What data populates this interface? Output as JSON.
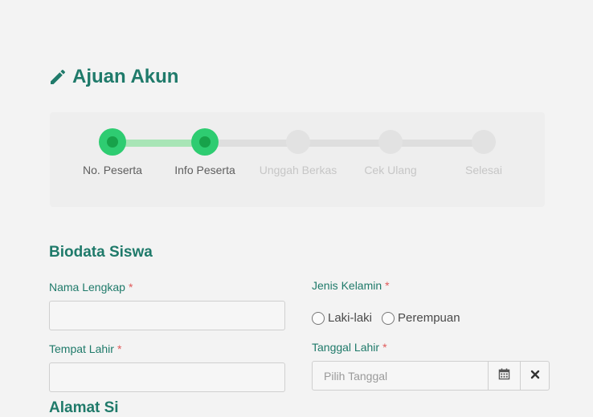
{
  "page": {
    "title": "Ajuan Akun",
    "title_icon": "pencil-icon"
  },
  "stepper": {
    "steps": [
      {
        "label": "No. Peserta",
        "active": true
      },
      {
        "label": "Info Peserta",
        "active": true
      },
      {
        "label": "Unggah Berkas",
        "active": false
      },
      {
        "label": "Cek Ulang",
        "active": false
      },
      {
        "label": "Selesai",
        "active": false
      }
    ],
    "current_step": 2
  },
  "form": {
    "section_title": "Biodata Siswa",
    "next_section_title": "Alamat Si",
    "required_marker": "*",
    "full_name": {
      "label": "Nama Lengkap",
      "value": ""
    },
    "birth_place": {
      "label": "Tempat Lahir",
      "value": ""
    },
    "gender": {
      "label": "Jenis Kelamin",
      "options": [
        "Laki-laki",
        "Perempuan"
      ]
    },
    "birth_date": {
      "label": "Tanggal Lahir",
      "placeholder": "Pilih Tanggal",
      "value": "",
      "calendar_icon": "calendar-icon",
      "clear_icon": "close-icon"
    }
  },
  "colors": {
    "primary": "#1f7a6a",
    "step_active": "#2ecc71",
    "step_active_core": "#17a24a",
    "required": "#e05a5a",
    "step_inactive": "#e2e2e2"
  }
}
